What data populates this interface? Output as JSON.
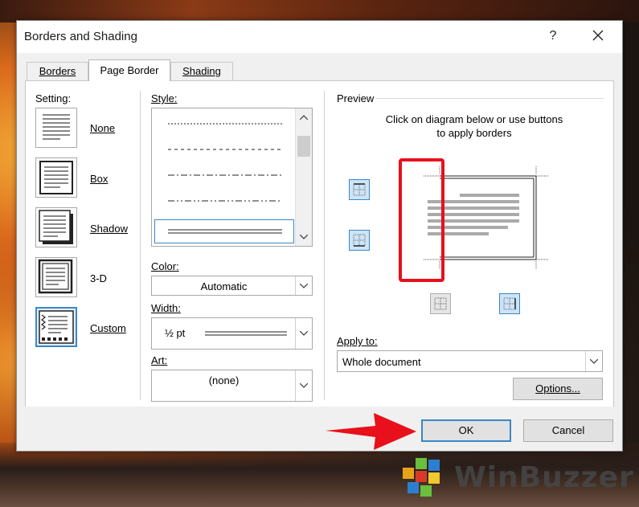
{
  "window": {
    "title": "Borders and Shading",
    "help_label": "?",
    "close_icon": "close-icon"
  },
  "tabs": [
    {
      "label": "Borders",
      "active": false
    },
    {
      "label": "Page Border",
      "active": true
    },
    {
      "label": "Shading",
      "active": false
    }
  ],
  "setting": {
    "label": "Setting:",
    "options": [
      {
        "label": "None",
        "icon": "setting-none-icon",
        "selected": false
      },
      {
        "label": "Box",
        "icon": "setting-box-icon",
        "selected": false
      },
      {
        "label": "Shadow",
        "icon": "setting-shadow-icon",
        "selected": false
      },
      {
        "label": "3-D",
        "icon": "setting-3d-icon",
        "selected": false
      },
      {
        "label": "Custom",
        "icon": "setting-custom-icon",
        "selected": true
      }
    ]
  },
  "style": {
    "label": "Style:",
    "items": [
      "dotted",
      "dashed",
      "dash-dot",
      "dash-dot-dot",
      "double"
    ],
    "selected_index": 4
  },
  "color": {
    "label": "Color:",
    "value": "Automatic"
  },
  "width": {
    "label": "Width:",
    "value": "½ pt"
  },
  "art": {
    "label": "Art:",
    "value": "(none)"
  },
  "preview": {
    "label": "Preview",
    "instruction_line1": "Click on diagram below or use buttons",
    "instruction_line2": "to apply borders",
    "buttons": [
      {
        "name": "top-border-button",
        "state": "on"
      },
      {
        "name": "bottom-border-button",
        "state": "on"
      },
      {
        "name": "left-border-button",
        "state": "off"
      },
      {
        "name": "right-border-button",
        "state": "on"
      }
    ]
  },
  "apply_to": {
    "label": "Apply to:",
    "value": "Whole document"
  },
  "options_label": "Options...",
  "ok_label": "OK",
  "cancel_label": "Cancel",
  "watermark": {
    "text": "WinBuzzer"
  },
  "annotation_colors": {
    "highlight": "#e8101a",
    "arrow": "#e8101a",
    "selection": "#3c86c8"
  }
}
